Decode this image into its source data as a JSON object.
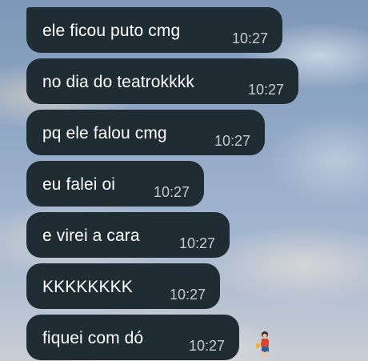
{
  "chat": {
    "messages": [
      {
        "text": "ele ficou puto cmg",
        "time": "10:27"
      },
      {
        "text": "no dia do teatrokkkk",
        "time": "10:27"
      },
      {
        "text": "pq ele falou cmg",
        "time": "10:27"
      },
      {
        "text": "eu falei oi",
        "time": "10:27"
      },
      {
        "text": "e virei a cara",
        "time": "10:27"
      },
      {
        "text": "KKKKKKKK",
        "time": "10:27"
      },
      {
        "text": "fiquei com dó",
        "time": "10:27"
      }
    ],
    "bubble_color": "#1f2c33",
    "text_color": "#ffffff",
    "time_color": "#c5cacd"
  },
  "wallpaper": {
    "description_icon": "child-figure-icon"
  }
}
